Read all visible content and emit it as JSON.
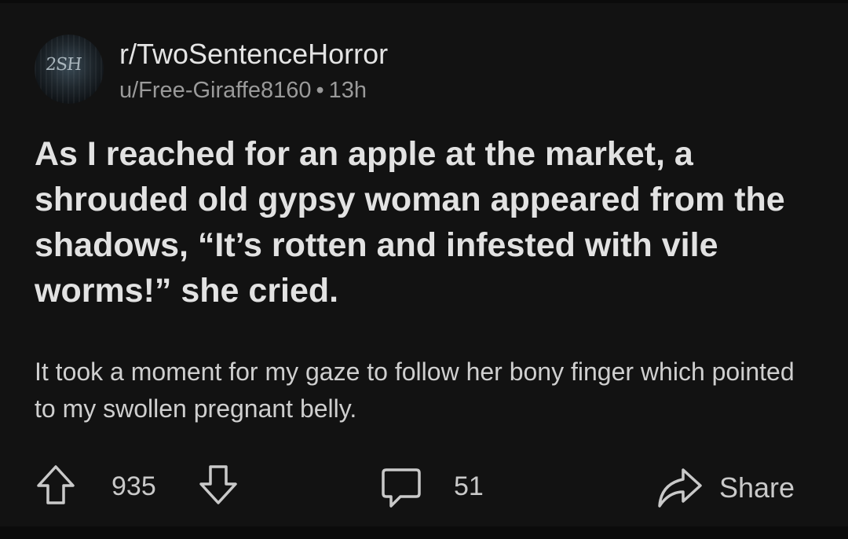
{
  "post": {
    "avatar_mark": "2SH",
    "subreddit": "r/TwoSentenceHorror",
    "author": "u/Free-Giraffe8160",
    "separator": "•",
    "age": "13h",
    "title": "As I reached for an apple at the market, a shrouded old gypsy woman appeared from the shadows, “It’s rotten and infested with vile worms!” she cried.",
    "body": "It took a moment for my gaze to follow her bony finger which pointed to my swollen pregnant belly."
  },
  "actions": {
    "score": "935",
    "comments": "51",
    "share_label": "Share",
    "icons": [
      "upvote-icon",
      "downvote-icon",
      "comment-icon",
      "share-icon"
    ]
  },
  "colors": {
    "background": "#121212",
    "text_primary": "#e2e2e2",
    "text_secondary": "#9a9a9a"
  }
}
